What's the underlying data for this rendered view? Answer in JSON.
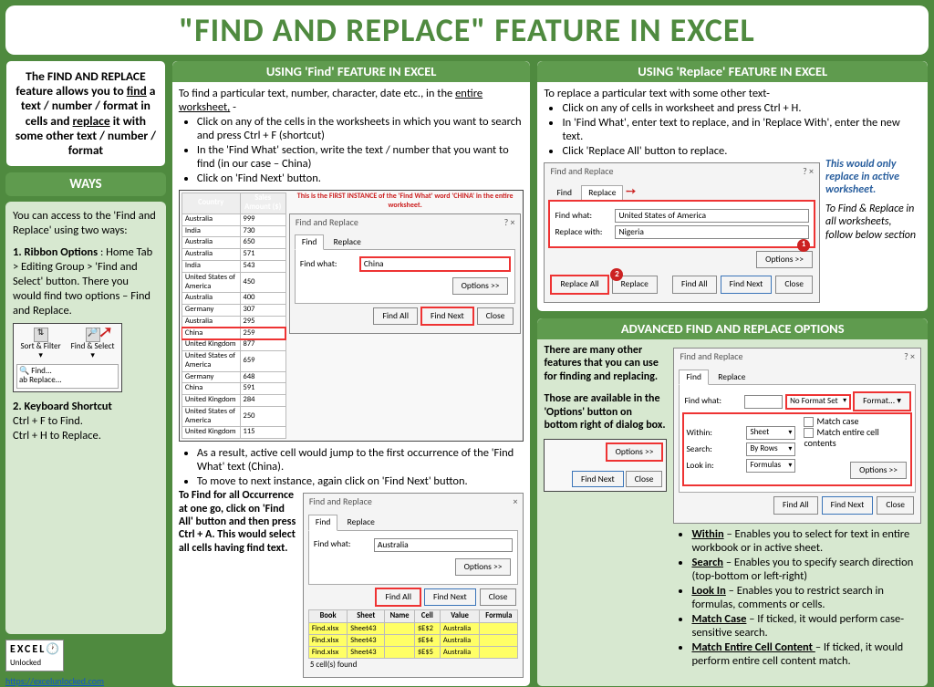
{
  "title": "\"FIND AND REPLACE\" FEATURE IN EXCEL",
  "intro": {
    "p1": "The FIND AND REPLACE feature allows you to ",
    "find": "find",
    "p2": " a text / number / format in cells and ",
    "replace": "replace",
    "p3": " it with some other text / number / format"
  },
  "ways": {
    "header": "WAYS",
    "intro": "You can access to the 'Find and Replace' using two ways:",
    "ribbon_title": "1. Ribbon Options",
    "ribbon_text": " : Home Tab > Editing Group > 'Find and Select' button. There you would find two options – Find and Replace.",
    "ribbon_menu": {
      "sort": "Sort & Filter ▾",
      "select": "Find & Select ▾",
      "find": "Find...",
      "replace": "Replace..."
    },
    "kb_title": "2. Keyboard Shortcut",
    "kb1": "Ctrl + F to Find.",
    "kb2": "Ctrl + H to Replace."
  },
  "logo_text": "EXCEL",
  "logo_sub": "Unlocked",
  "link": "https://excelunlocked.com",
  "find": {
    "header": "USING 'Find' FEATURE IN EXCEL",
    "intro": "To find a particular text, number, character, date etc., in the ",
    "intro_u": "entire worksheet,",
    "intro2": " -",
    "b1": "Click on any of the cells in the worksheets in which you want to search and press Ctrl + F (shortcut)",
    "b2": "In the 'Find What' section, write the text / number that you want to find (in our case – China)",
    "b3": "Click on 'Find Next' button.",
    "caption": "This is the FIRST INSTANCE of the 'Find What' word 'CHINA' in the entire worksheet.",
    "table": {
      "h1": "Country",
      "h2": "Sales Amount ($)",
      "rows": [
        [
          "Australia",
          "999"
        ],
        [
          "India",
          "730"
        ],
        [
          "Australia",
          "650"
        ],
        [
          "Australia",
          "571"
        ],
        [
          "India",
          "543"
        ],
        [
          "United States of America",
          "450"
        ],
        [
          "Australia",
          "400"
        ],
        [
          "Germany",
          "307"
        ],
        [
          "Australia",
          "295"
        ],
        [
          "China",
          "259"
        ],
        [
          "United Kingdom",
          "877"
        ],
        [
          "United States of America",
          "659"
        ],
        [
          "Germany",
          "648"
        ],
        [
          "China",
          "591"
        ],
        [
          "United Kingdom",
          "284"
        ],
        [
          "United States of America",
          "250"
        ],
        [
          "United Kingdom",
          "115"
        ]
      ]
    },
    "dlg": {
      "title": "Find and Replace",
      "tab_find": "Find",
      "tab_replace": "Replace",
      "lbl_find": "Find what:",
      "val_find": "China",
      "options": "Options >>",
      "find_all": "Find All",
      "find_next": "Find Next",
      "close": "Close"
    },
    "after1": "As a result, active cell would jump to the first occurrence of the 'Find What' text (China).",
    "after2": "To move to next instance, again click on 'Find Next' button.",
    "findall_text": "To Find for all Occurrence at one go, click on 'Find All' button and then press Ctrl + A. This would select all cells having find text.",
    "dlg2": {
      "title": "Find and Replace",
      "tab_find": "Find",
      "tab_replace": "Replace",
      "lbl_find": "Find what:",
      "val_find": "Australia",
      "options": "Options >>",
      "find_all": "Find All",
      "find_next": "Find Next",
      "close": "Close",
      "cols": [
        "Book",
        "Sheet",
        "Name",
        "Cell",
        "Value",
        "Formula"
      ],
      "results": [
        [
          "Find.xlsx",
          "Sheet43",
          "",
          "$E$2",
          "Australia",
          ""
        ],
        [
          "Find.xlsx",
          "Sheet43",
          "",
          "$E$4",
          "Australia",
          ""
        ],
        [
          "Find.xlsx",
          "Sheet43",
          "",
          "$E$5",
          "Australia",
          ""
        ]
      ],
      "status": "5 cell(s) found"
    }
  },
  "replace": {
    "header": "USING 'Replace' FEATURE IN EXCEL",
    "intro": "To replace a particular text with some other text-",
    "b1": "Click on any of cells in worksheet and press Ctrl + H.",
    "b2": "In 'Find What', enter text to replace, and in 'Replace With', enter the new text.",
    "b3": "Click 'Replace All' button to replace.",
    "dlg": {
      "title": "Find and Replace",
      "tab_find": "Find",
      "tab_replace": "Replace",
      "lbl_find": "Find what:",
      "val_find": "United States of America",
      "lbl_replace": "Replace with:",
      "val_replace": "Nigeria",
      "options": "Options >>",
      "replace_all": "Replace All",
      "replace": "Replace",
      "find_all": "Find All",
      "find_next": "Find Next",
      "close": "Close"
    },
    "note1": "This would only replace in active worksheet.",
    "note2": "To Find & Replace in all worksheets, follow below section"
  },
  "adv": {
    "header": "ADVANCED FIND AND REPLACE OPTIONS",
    "left1": "There are many other features that you can use for finding and replacing.",
    "left2": "Those are available in the 'Options' button on bottom right of dialog box.",
    "dlg": {
      "title": "Find and Replace",
      "tab_find": "Find",
      "tab_replace": "Replace",
      "lbl_find": "Find what:",
      "noformat": "No Format Set",
      "format": "Format... ▾",
      "lbl_within": "Within:",
      "val_within": "Sheet",
      "lbl_search": "Search:",
      "val_search": "By Rows",
      "lbl_look": "Look in:",
      "val_look": "Formulas",
      "chk_case": "Match case",
      "chk_entire": "Match entire cell contents",
      "options": "Options >>",
      "find_all": "Find All",
      "find_next": "Find Next",
      "close": "Close"
    },
    "bullets": [
      {
        "t": "Within",
        "d": " – Enables you to select for text in entire workbook or in active sheet."
      },
      {
        "t": "Search",
        "d": " – Enables you to specify search direction (top-bottom or left-right)"
      },
      {
        "t": "Look In",
        "d": " – Enables you to restrict search in formulas, comments or cells."
      },
      {
        "t": "Match Case",
        "d": " – If ticked, it would perform case-sensitive search."
      },
      {
        "t": "Match Entire Cell Content ",
        "d": "– If ticked, it would perform entire cell content match."
      }
    ]
  }
}
